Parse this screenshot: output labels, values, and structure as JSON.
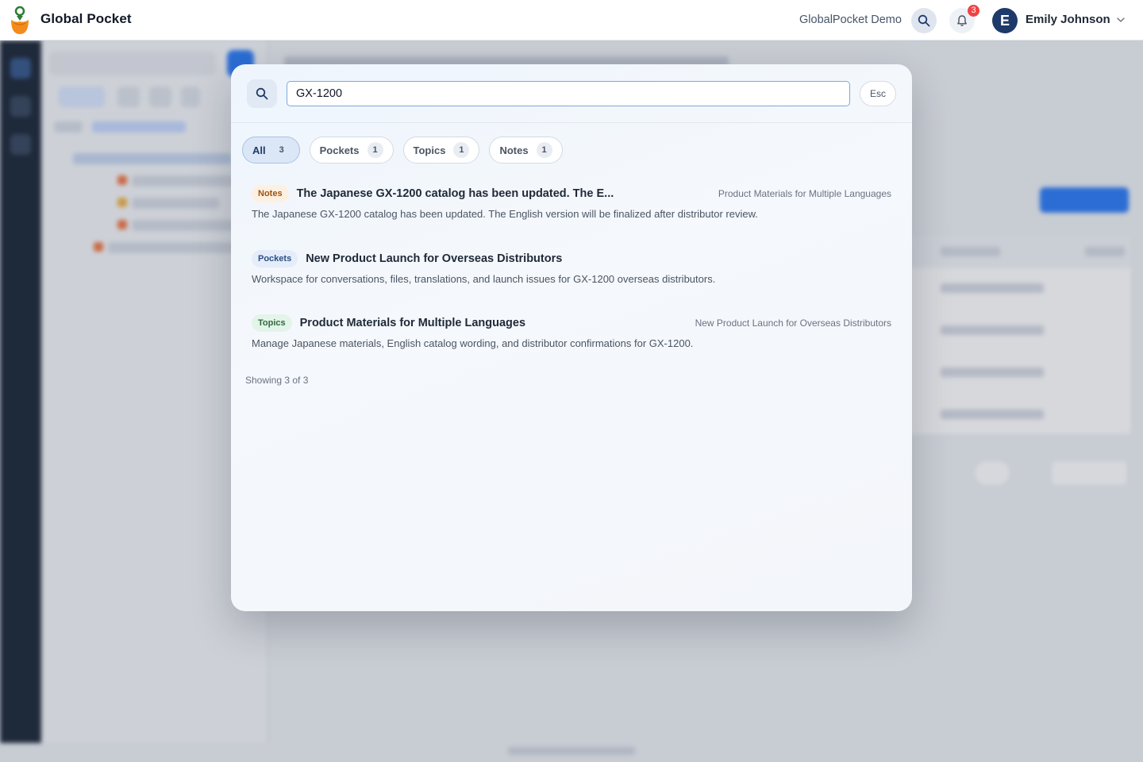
{
  "header": {
    "app_name": "Global Pocket",
    "workspace": "GlobalPocket Demo",
    "notification_count": "3",
    "user_initial": "E",
    "user_name": "Emily Johnson"
  },
  "search": {
    "query": "GX-1200",
    "esc_label": "Esc",
    "tabs": [
      {
        "label": "All",
        "count": "3"
      },
      {
        "label": "Pockets",
        "count": "1"
      },
      {
        "label": "Topics",
        "count": "1"
      },
      {
        "label": "Notes",
        "count": "1"
      }
    ],
    "results": [
      {
        "type": "Notes",
        "title": "The Japanese GX-1200 catalog has been updated. The E...",
        "context": "Product Materials for Multiple Languages",
        "description": "The Japanese GX-1200 catalog has been updated. The English version will be finalized after distributor review."
      },
      {
        "type": "Pockets",
        "title": "New Product Launch for Overseas Distributors",
        "context": "",
        "description": "Workspace for conversations, files, translations, and launch issues for GX-1200 overseas distributors."
      },
      {
        "type": "Topics",
        "title": "Product Materials for Multiple Languages",
        "context": "New Product Launch for Overseas Distributors",
        "description": "Manage Japanese materials, English catalog wording, and distributor confirmations for GX-1200."
      }
    ],
    "showing": "Showing 3 of 3"
  },
  "colors": {
    "accent": "#2f7df6",
    "avatar": "#1e3a6b",
    "badge": "#ef4444",
    "rail": "#1f2a3a"
  }
}
